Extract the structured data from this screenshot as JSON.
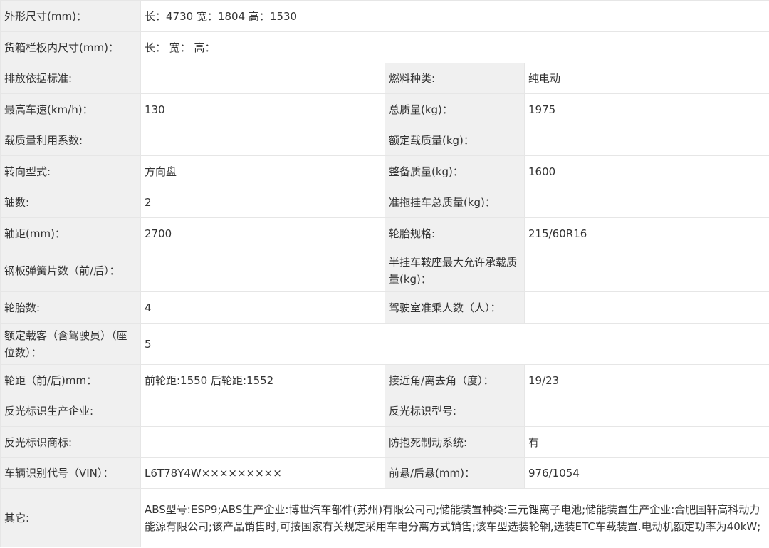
{
  "rows": [
    {
      "label": "外形尺寸(mm)：",
      "value": "长：4730 宽：1804 高：1530"
    },
    {
      "label": "货箱栏板内尺寸(mm)：",
      "value": "长： 宽： 高："
    },
    {
      "label": "排放依据标准:",
      "value": "",
      "label2": "燃料种类:",
      "value2": "纯电动"
    },
    {
      "label": "最高车速(km/h)：",
      "value": "130",
      "label2": "总质量(kg)：",
      "value2": "1975"
    },
    {
      "label": "载质量利用系数:",
      "value": "",
      "label2": "额定载质量(kg)：",
      "value2": ""
    },
    {
      "label": "转向型式:",
      "value": "方向盘",
      "label2": "整备质量(kg)：",
      "value2": "1600"
    },
    {
      "label": "轴数:",
      "value": "2",
      "label2": "准拖挂车总质量(kg)：",
      "value2": ""
    },
    {
      "label": "轴距(mm)：",
      "value": "2700",
      "label2": "轮胎规格:",
      "value2": "215/60R16"
    },
    {
      "label": "钢板弹簧片数（前/后）：",
      "value": "",
      "label2": "半挂车鞍座最大允许承载质量(kg)：",
      "value2": ""
    },
    {
      "label": "轮胎数:",
      "value": "4",
      "label2": "驾驶室准乘人数（人）：",
      "value2": ""
    },
    {
      "label": "额定载客（含驾驶员）（座位数）：",
      "value": "5"
    },
    {
      "label": "轮距（前/后)mm：",
      "value": "前轮距:1550 后轮距:1552",
      "label2": "接近角/离去角（度）：",
      "value2": "19/23"
    },
    {
      "label": "反光标识生产企业:",
      "value": "",
      "label2": "反光标识型号:",
      "value2": ""
    },
    {
      "label": "反光标识商标:",
      "value": "",
      "label2": "防抱死制动系统:",
      "value2": "有"
    },
    {
      "label": "车辆识别代号（VIN）：",
      "value": "L6T78Y4W×××××××××",
      "label2": "前悬/后悬(mm)：",
      "value2": "976/1054"
    },
    {
      "label": "其它:",
      "value": "ABS型号:ESP9;ABS生产企业:博世汽车部件(苏州)有限公司司;储能装置种类:三元锂离子电池;储能装置生产企业:合肥国轩高科动力能源有限公司;该产品销售时,可按国家有关规定采用车电分离方式销售;该车型选装轮辋,选装ETC车载装置.电动机额定功率为40kW;"
    }
  ]
}
